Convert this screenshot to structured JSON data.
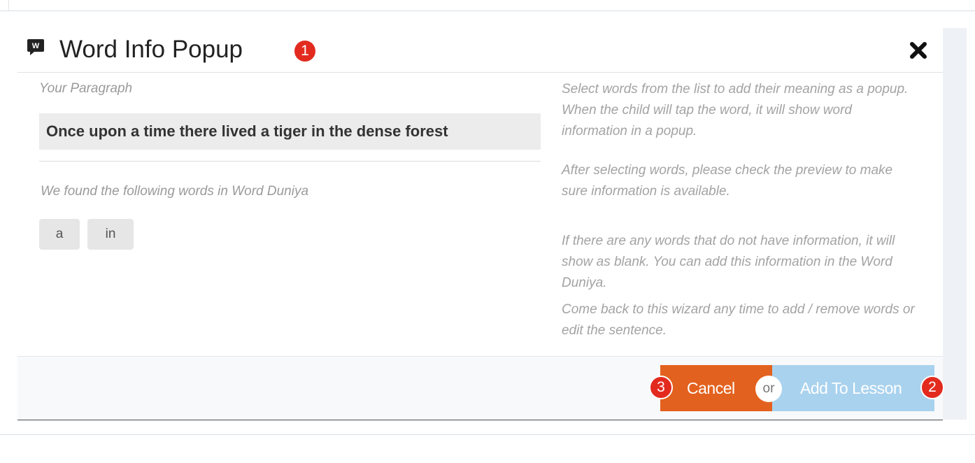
{
  "modal": {
    "title": "Word Info Popup",
    "title_badge": "1",
    "header_icon": "word-bubble-icon",
    "close_icon": "close-icon"
  },
  "left": {
    "paragraph_label": "Your Paragraph",
    "paragraph_text": "Once upon a time there lived a tiger in the dense forest",
    "found_label": "We found the following words in Word Duniya",
    "words": [
      "a",
      "in"
    ]
  },
  "help": [
    "Select words from the list to add their meaning as a popup. When the child will tap the word, it will show word information in a popup.",
    "After selecting words, please check the preview to make sure information is available.",
    "If there are any words that do not have information, it will show as blank. You can add this information in the Word Duniya.",
    "Come back to this wizard any time to add / remove words or edit the sentence."
  ],
  "footer": {
    "cancel_label": "Cancel",
    "cancel_badge": "3",
    "or_label": "or",
    "add_label": "Add To Lesson",
    "add_badge": "2"
  },
  "colors": {
    "cancel": "#e3611e",
    "add_to_lesson": "#a9d2ee",
    "badge": "#e32a1f"
  }
}
